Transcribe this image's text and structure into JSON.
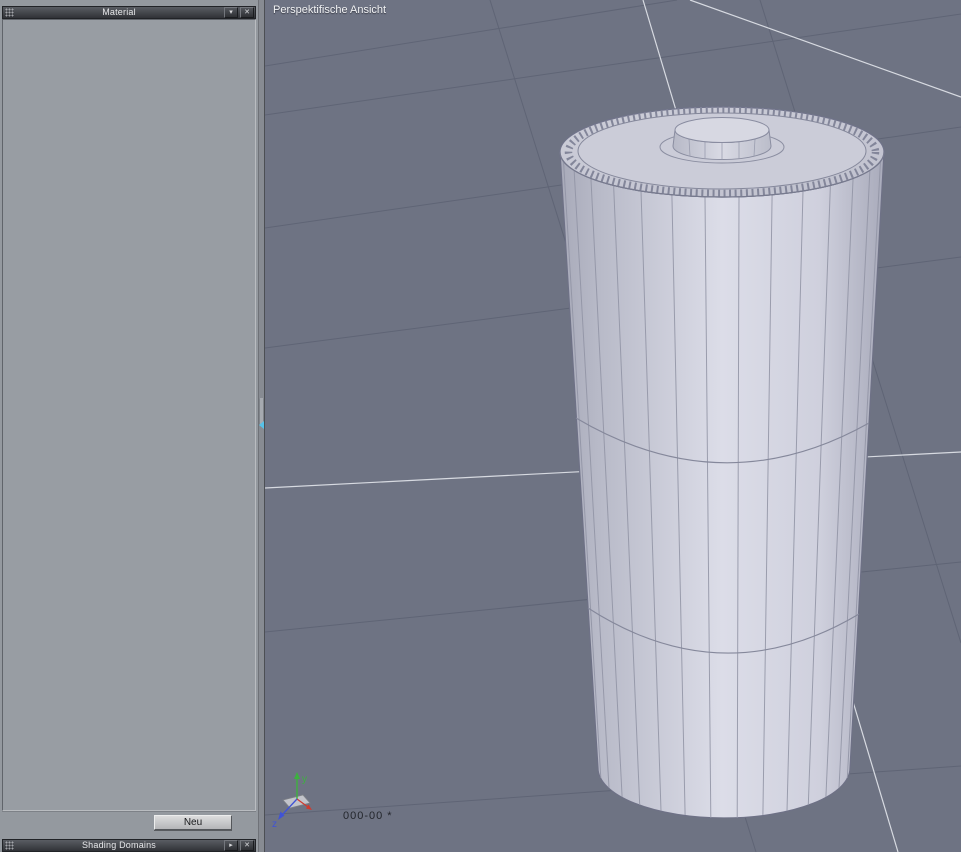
{
  "material_panel": {
    "title": "Material",
    "menu_button_icon": "▾",
    "close_button_icon": "✕",
    "new_button_label": "Neu"
  },
  "shading_domains_panel": {
    "title": "Shading Domains",
    "expand_button_icon": "▸",
    "close_button_icon": "✕"
  },
  "viewport": {
    "title": "Perspektifische Ansicht",
    "status": "000-00 *",
    "axis_labels": {
      "y": "y",
      "z": "z"
    },
    "colors": {
      "viewport_background": "#6e7383",
      "grid_line": "#5a6071",
      "axis_line_bright": "#e3e6ec",
      "model_surface": "#cfd0dd",
      "model_wireframe": "#9093a4",
      "model_edge": "#6e7186",
      "axis_y_green": "#3db13f",
      "axis_x_red": "#d03a2e",
      "axis_z_blue": "#4053d6"
    }
  }
}
